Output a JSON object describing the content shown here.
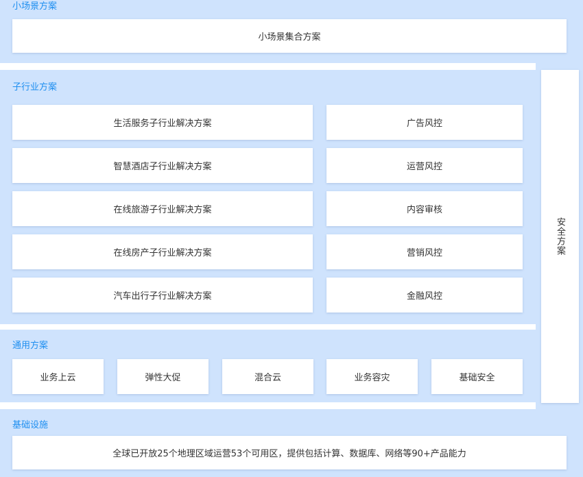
{
  "small_scene": {
    "title": "小场景方案",
    "items": [
      "小场景集合方案"
    ]
  },
  "sub_industry": {
    "title": "子行业方案",
    "left_items": [
      "生活服务子行业解决方案",
      "智慧酒店子行业解决方案",
      "在线旅游子行业解决方案",
      "在线房产子行业解决方案",
      "汽车出行子行业解决方案"
    ],
    "right_items": [
      "广告风控",
      "运营风控",
      "内容审核",
      "营销风控",
      "金融风控"
    ]
  },
  "general": {
    "title": "通用方案",
    "items": [
      "业务上云",
      "弹性大促",
      "混合云",
      "业务容灾",
      "基础安全"
    ]
  },
  "security": {
    "label": "安全方案"
  },
  "infrastructure": {
    "title": "基础设施",
    "items": [
      "全球已开放25个地理区域运营53个可用区，提供包括计算、数据库、网络等90+产品能力"
    ]
  }
}
